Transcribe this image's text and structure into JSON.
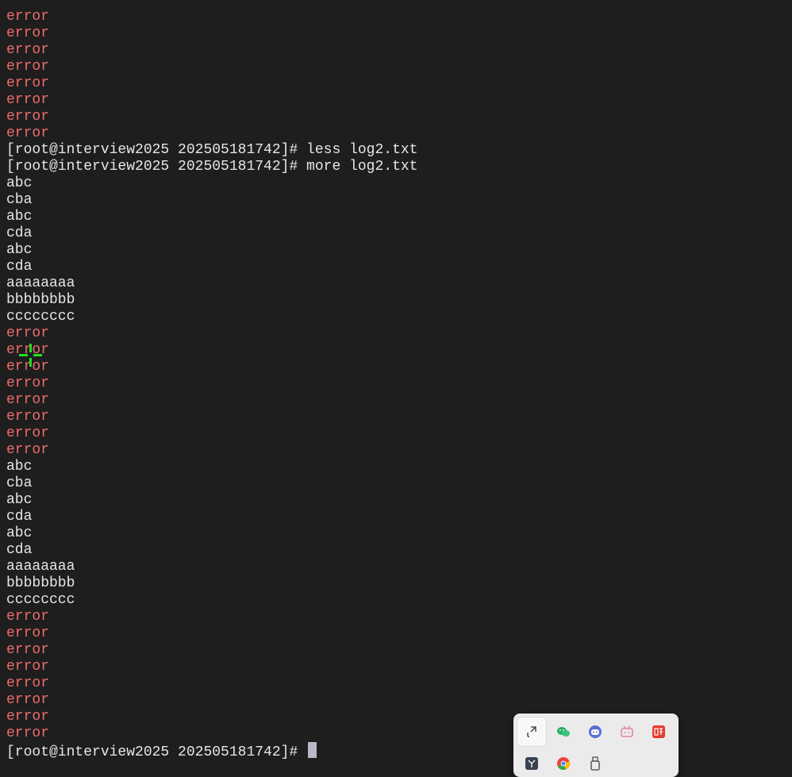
{
  "terminal": {
    "lines": [
      {
        "text": "error",
        "type": "error"
      },
      {
        "text": "error",
        "type": "error"
      },
      {
        "text": "error",
        "type": "error"
      },
      {
        "text": "error",
        "type": "error"
      },
      {
        "text": "error",
        "type": "error"
      },
      {
        "text": "error",
        "type": "error"
      },
      {
        "text": "error",
        "type": "error"
      },
      {
        "text": "error",
        "type": "error"
      },
      {
        "text": "[root@interview2025 202505181742]# less log2.txt",
        "type": "prompt"
      },
      {
        "text": "[root@interview2025 202505181742]# more log2.txt",
        "type": "prompt"
      },
      {
        "text": "abc",
        "type": "output"
      },
      {
        "text": "cba",
        "type": "output"
      },
      {
        "text": "abc",
        "type": "output"
      },
      {
        "text": "cda",
        "type": "output"
      },
      {
        "text": "abc",
        "type": "output"
      },
      {
        "text": "cda",
        "type": "output"
      },
      {
        "text": "aaaaaaaa",
        "type": "output"
      },
      {
        "text": "bbbbbbbb",
        "type": "output"
      },
      {
        "text": "cccccccc",
        "type": "output"
      },
      {
        "text": "error",
        "type": "error"
      },
      {
        "text": "error",
        "type": "error"
      },
      {
        "text": "error",
        "type": "error"
      },
      {
        "text": "error",
        "type": "error"
      },
      {
        "text": "error",
        "type": "error"
      },
      {
        "text": "error",
        "type": "error"
      },
      {
        "text": "error",
        "type": "error"
      },
      {
        "text": "error",
        "type": "error"
      },
      {
        "text": "abc",
        "type": "output"
      },
      {
        "text": "cba",
        "type": "output"
      },
      {
        "text": "abc",
        "type": "output"
      },
      {
        "text": "cda",
        "type": "output"
      },
      {
        "text": "abc",
        "type": "output"
      },
      {
        "text": "cda",
        "type": "output"
      },
      {
        "text": "aaaaaaaa",
        "type": "output"
      },
      {
        "text": "bbbbbbbb",
        "type": "output"
      },
      {
        "text": "cccccccc",
        "type": "output"
      },
      {
        "text": "error",
        "type": "error"
      },
      {
        "text": "error",
        "type": "error"
      },
      {
        "text": "error",
        "type": "error"
      },
      {
        "text": "error",
        "type": "error"
      },
      {
        "text": "error",
        "type": "error"
      },
      {
        "text": "error",
        "type": "error"
      },
      {
        "text": "error",
        "type": "error"
      },
      {
        "text": "error",
        "type": "error"
      }
    ],
    "current_prompt": "[root@interview2025 202505181742]# "
  },
  "colors": {
    "background": "#1e1e1e",
    "text": "#e6e6e6",
    "error": "#f06b6b",
    "cursor": "#b8b8c8",
    "crosshair": "#22dd22"
  },
  "tray": {
    "icons": [
      {
        "name": "pen-input-icon"
      },
      {
        "name": "wechat-icon"
      },
      {
        "name": "assistant-bot-icon"
      },
      {
        "name": "bilibili-icon"
      },
      {
        "name": "listen-app-icon"
      },
      {
        "name": "terminal-app-icon"
      },
      {
        "name": "chrome-icon"
      },
      {
        "name": "usb-drive-icon"
      }
    ]
  }
}
